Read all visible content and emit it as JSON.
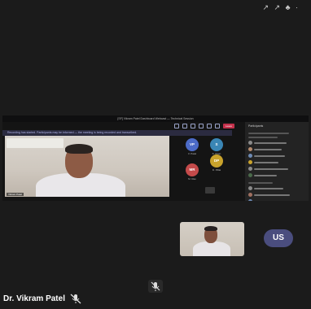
{
  "status_bar": {
    "icons": "↗ ↗ ♣ ·"
  },
  "shared_screen": {
    "title": "[SF] Vikram Patel Dashboard Webcast — Technical Session",
    "leave_label": "Leave",
    "banner_text": "Recording has started. Participants may be informed — the meeting is being recorded and transcribed.",
    "main_participant_label": "Vikram Patel",
    "gallery": [
      {
        "initials": "VP",
        "name": "V. Patel",
        "color": "#4c6bc7"
      },
      {
        "initials": "S",
        "name": "S. Khan",
        "color": "#3a86b5"
      },
      {
        "initials": "DP",
        "name": "D. Pillai",
        "color": "#c9a32c"
      },
      {
        "initials": "MR",
        "name": "M. Rao",
        "color": "#c44a4a"
      }
    ],
    "panel_title": "Participants"
  },
  "tiles": {
    "self_avatar_initials": "US"
  },
  "footer": {
    "presenter_name": "Dr. Vikram Patel"
  },
  "colors": {
    "background": "#1b1b1b",
    "avatar_us": "#4a4d7e",
    "leave": "#c4314b"
  }
}
